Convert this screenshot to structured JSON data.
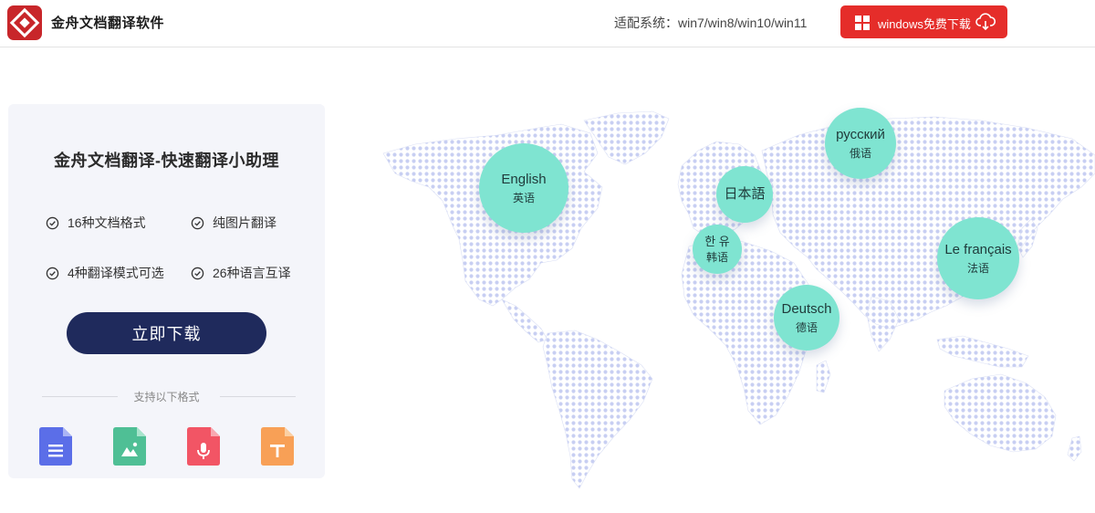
{
  "header": {
    "app_name": "金舟文档翻译软件",
    "system_info": "适配系统：win7/win8/win10/win11",
    "download_label": "windows免费下载"
  },
  "panel": {
    "title": "金舟文档翻译-快速翻译小助理",
    "features": [
      "16种文档格式",
      "纯图片翻译",
      "4种翻译模式可选",
      "26种语言互译"
    ],
    "cta_label": "立即下载",
    "support_label": "支持以下格式",
    "formats": [
      {
        "name": "document",
        "color": "#5b6ee8"
      },
      {
        "name": "image",
        "color": "#4fbf95"
      },
      {
        "name": "audio",
        "color": "#f25565"
      },
      {
        "name": "text",
        "color": "#f8a056"
      }
    ]
  },
  "map": {
    "dot_color": "#c8cff2",
    "bubbles": [
      {
        "lang": "English",
        "cn": "英语"
      },
      {
        "lang": "日本語",
        "cn": ""
      },
      {
        "lang": "русский",
        "cn": "俄语"
      },
      {
        "lang": "한 유",
        "cn": "韩语"
      },
      {
        "lang": "Le français",
        "cn": "法语"
      },
      {
        "lang": "Deutsch",
        "cn": "德语"
      }
    ]
  },
  "colors": {
    "brand_red": "#e52d2a",
    "cta_navy": "#1f2a5c",
    "bubble_teal": "#7fe4d1"
  }
}
